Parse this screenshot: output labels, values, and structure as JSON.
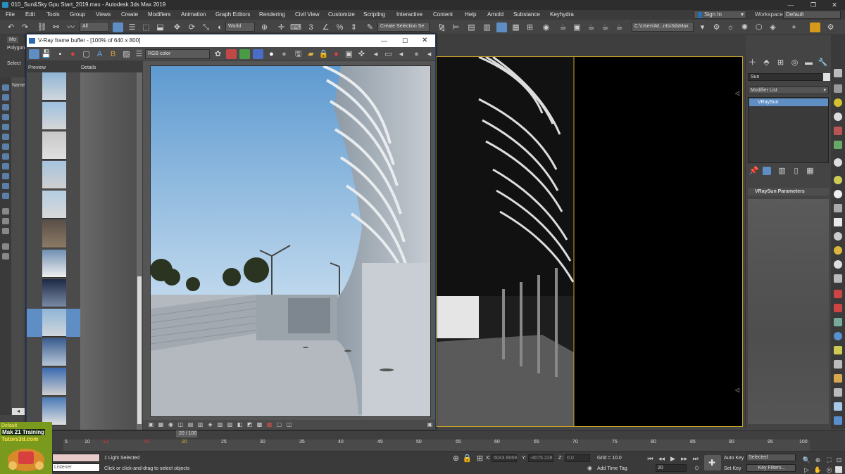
{
  "app": {
    "title": "010_Sun&Sky Gpu Start_2019.max - Autodesk 3ds Max 2019",
    "window_controls": [
      "—",
      "❐",
      "✕"
    ]
  },
  "menu": {
    "items": [
      "File",
      "Edit",
      "Tools",
      "Group",
      "Views",
      "Create",
      "Modifiers",
      "Animation",
      "Graph Editors",
      "Rendering",
      "Civil View",
      "Customize",
      "Scripting",
      "Interactive",
      "Content",
      "Help",
      "Arnold",
      "Substance",
      "Keyhydra"
    ],
    "sign_in": "Sign In",
    "workspaces_label": "Workspaces:",
    "workspaces_value": "Default"
  },
  "toolbar": {
    "filter_dropdown": "All",
    "coord_dropdown": "World",
    "selection_set": "Create Selection Se",
    "path_field": "C:\\Users\\M...nts\\3dsMax"
  },
  "ribbon": {
    "tab_label": "Mo",
    "polygon_label": "Polygon",
    "select_label": "Select",
    "name_label": "Name"
  },
  "vfb": {
    "title": "V-Ray frame buffer - [100% of 640 x 800]",
    "channel": "RGB color",
    "history_preview_label": "Preview",
    "history_details_label": "Details",
    "frame_readout": "20 / 100"
  },
  "command_panel": {
    "object_name": "Sun",
    "modifier_list": "Modifier List",
    "stack_item": "VRaySun",
    "rollout_title": "VRaySun Parameters"
  },
  "timeline": {
    "ticks": [
      "5",
      "10",
      "13",
      "15",
      "20",
      "25",
      "30",
      "35",
      "40",
      "45",
      "50",
      "55",
      "60",
      "65",
      "70",
      "75",
      "80",
      "85",
      "90",
      "95",
      "100"
    ]
  },
  "status": {
    "default_label": "Default",
    "logo_line1": "Mak 21 Training",
    "logo_line2": "Tutors3d.com",
    "listener": "Listener",
    "selection_info": "1 Light Selected",
    "prompt": "Click or click-and-drag to select objects",
    "x_label": "X:",
    "x_value": "5043.9069",
    "y_label": "Y:",
    "y_value": "-4075.228",
    "z_label": "Z:",
    "z_value": "0.0",
    "grid": "Grid = 10.0",
    "add_time_tag": "Add Time Tag",
    "auto_key": "Auto Key",
    "set_key": "Set Key",
    "selected_dropdown": "Selected",
    "key_filters": "Key Filters...",
    "frame_field": "20"
  },
  "colors": {
    "accent": "#5e8ec4",
    "viewport_border": "#c8a62c",
    "logo_green": "#7a9a1e"
  }
}
